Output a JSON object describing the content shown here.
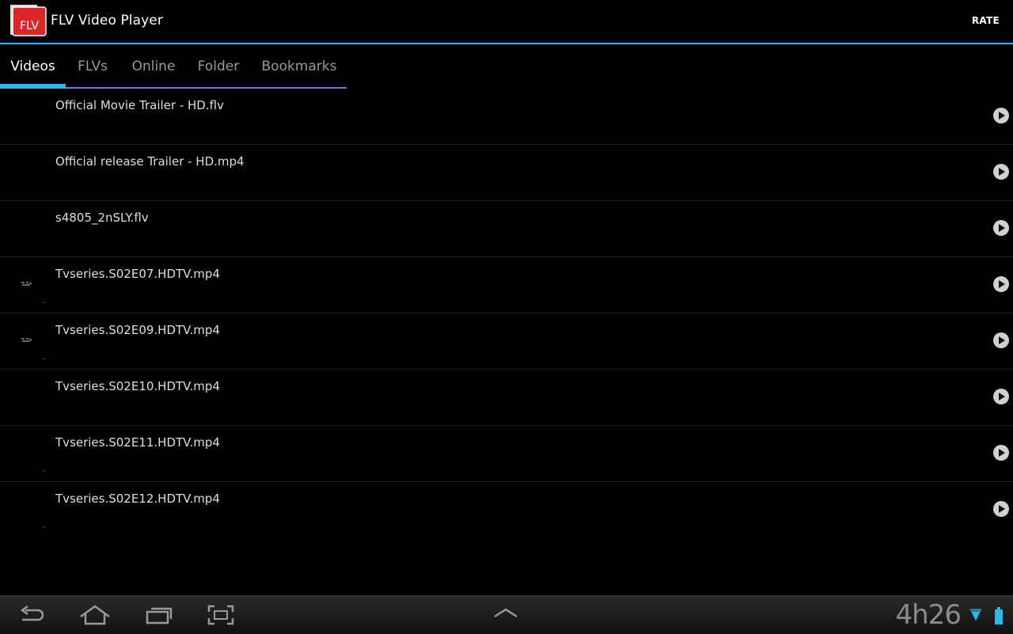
{
  "header": {
    "app_icon_text": "FLV",
    "title": "FLV Video Player",
    "rate_label": "RATE"
  },
  "tabs": [
    {
      "label": "Videos",
      "active": true
    },
    {
      "label": "FLVs",
      "active": false
    },
    {
      "label": "Online",
      "active": false
    },
    {
      "label": "Folder",
      "active": false
    },
    {
      "label": "Bookmarks",
      "active": false
    }
  ],
  "videos": [
    {
      "title": "Official Movie Trailer - HD.flv"
    },
    {
      "title": "Official release Trailer - HD.mp4"
    },
    {
      "title": "s4805_2nSLY.flv"
    },
    {
      "title": "Tvseries.S02E07.HDTV.mp4"
    },
    {
      "title": "Tvseries.S02E09.HDTV.mp4"
    },
    {
      "title": "Tvseries.S02E10.HDTV.mp4"
    },
    {
      "title": "Tvseries.S02E11.HDTV.mp4"
    },
    {
      "title": "Tvseries.S02E12.HDTV.mp4"
    }
  ],
  "system_bar": {
    "clock": "4h26",
    "icons": [
      "back-icon",
      "home-icon",
      "recent-apps-icon",
      "screenshot-icon",
      "menu-up-icon",
      "wifi-icon",
      "battery-icon"
    ]
  },
  "colors": {
    "accent": "#33b5e5",
    "tab_underline": "#6b7fd6",
    "icon_red": "#d92626"
  }
}
